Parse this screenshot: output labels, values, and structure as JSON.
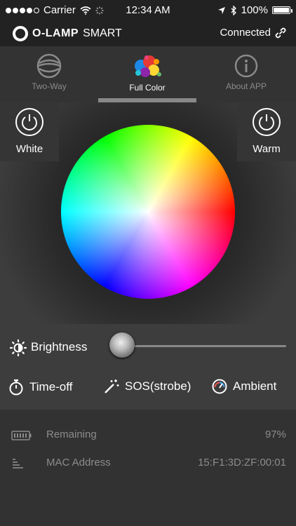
{
  "status_bar": {
    "carrier": "Carrier",
    "time": "12:34 AM",
    "battery": "100%"
  },
  "header": {
    "logo_bold": "O-LAMP",
    "logo_rest": "SMART",
    "connection_status": "Connected"
  },
  "tabs": [
    {
      "label": "Two-Way",
      "icon": "two-way-icon",
      "active": false
    },
    {
      "label": "Full Color",
      "icon": "paint-splash-icon",
      "active": true
    },
    {
      "label": "About APP",
      "icon": "info-icon",
      "active": false
    }
  ],
  "color_panel": {
    "white_label": "White",
    "warm_label": "Warm"
  },
  "controls": {
    "brightness_label": "Brightness",
    "brightness_level": 0,
    "timeoff_label": "Time-off",
    "sos_label": "SOS(strobe)",
    "ambient_label": "Ambient"
  },
  "info": {
    "remaining_label": "Remaining",
    "remaining_value": "97%",
    "mac_label": "MAC Address",
    "mac_value": "15:F1:3D:ZF:00:01"
  }
}
